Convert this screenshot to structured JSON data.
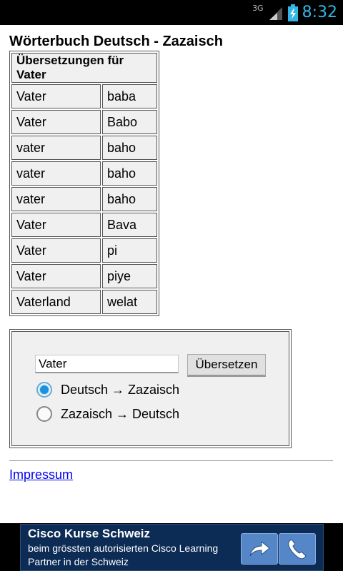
{
  "status_bar": {
    "network": "3G",
    "time": "8:32",
    "accent_color": "#33b5e5"
  },
  "page_title": "Wörterbuch Deutsch - Zazaisch",
  "results": {
    "header": "Übersetzungen für Vater",
    "rows": [
      {
        "de": "Vater",
        "zza": "baba"
      },
      {
        "de": "Vater",
        "zza": "Babo"
      },
      {
        "de": "vater",
        "zza": "baho"
      },
      {
        "de": "vater",
        "zza": "baho"
      },
      {
        "de": "vater",
        "zza": "baho"
      },
      {
        "de": "Vater",
        "zza": "Bava"
      },
      {
        "de": "Vater",
        "zza": "pi"
      },
      {
        "de": "Vater",
        "zza": "piye"
      },
      {
        "de": "Vaterland",
        "zza": "welat"
      }
    ]
  },
  "form": {
    "input_value": "Vater",
    "submit_label": "Übersetzen",
    "options": [
      {
        "label": "Deutsch → Zazaisch",
        "checked": true
      },
      {
        "label": "Zazaisch → Deutsch",
        "checked": false
      }
    ]
  },
  "impressum_link": "Impressum",
  "ad": {
    "title": "Cisco Kurse Schweiz",
    "text": "beim grössten autorisierten Cisco Learning Partner in der Schweiz",
    "buttons": [
      "arrow-icon",
      "phone-icon"
    ]
  }
}
